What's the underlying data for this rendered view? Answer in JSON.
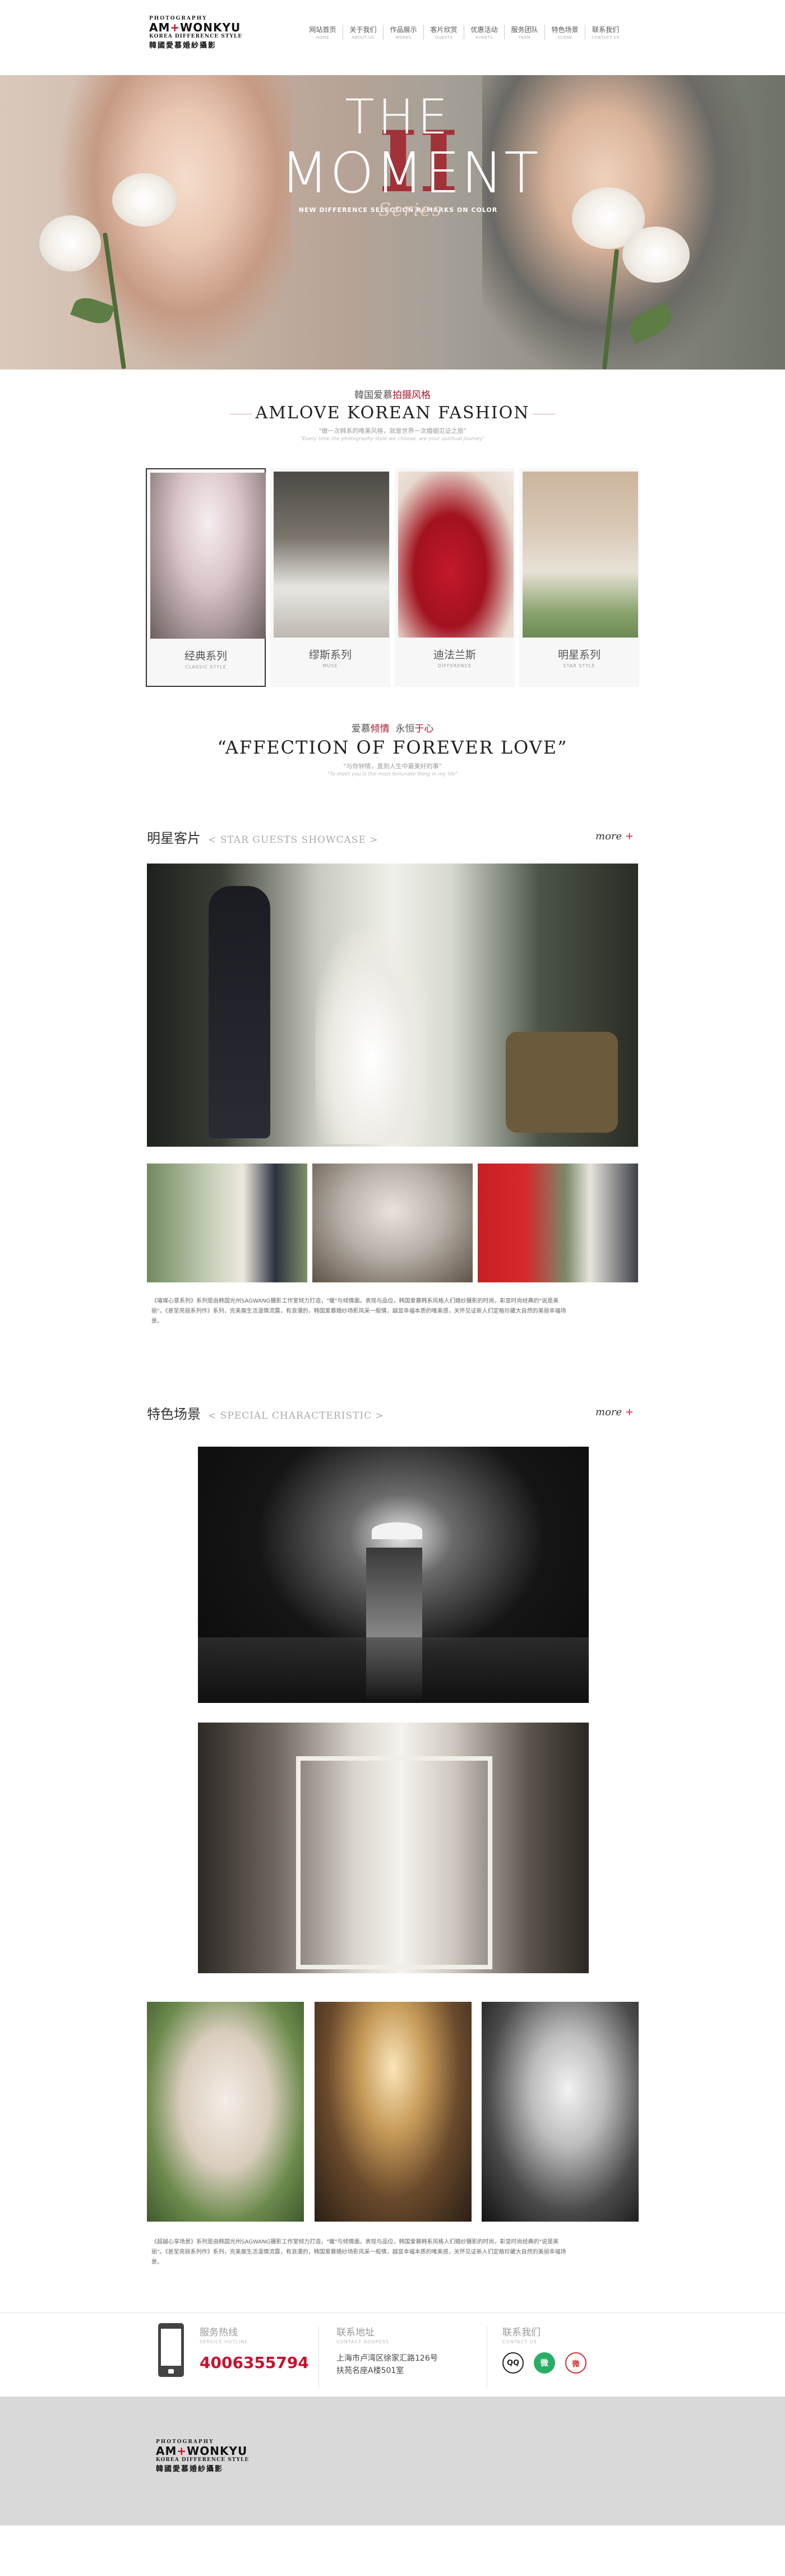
{
  "brand": {
    "line1": "PHOTOGRAPHY",
    "name_left": "AM",
    "name_plus": "+",
    "name_right": "WONKYU",
    "line3": "KOREA DIFFERENCE STYLE",
    "line4": "韓國愛慕婚紗攝影"
  },
  "nav": [
    {
      "cn": "网站首页",
      "en": "HOME"
    },
    {
      "cn": "关于我们",
      "en": "ABOUT US"
    },
    {
      "cn": "作品展示",
      "en": "WORKS"
    },
    {
      "cn": "客片欣赏",
      "en": "GUESTS"
    },
    {
      "cn": "优惠活动",
      "en": "EVENTS"
    },
    {
      "cn": "服务团队",
      "en": "TEAM"
    },
    {
      "cn": "特色场景",
      "en": "SCENE"
    },
    {
      "cn": "联系我们",
      "en": "CONTACT US"
    }
  ],
  "hero": {
    "the": "THE",
    "moment": "MOMENT",
    "numeral": "II",
    "series": "Series",
    "subtitle": "NEW DIFFERENCE SELECTION REMARKS ON COLOR"
  },
  "fashion": {
    "cn_prefix": "韓国爱慕",
    "cn_red": "拍摄风格",
    "en_title": "AMLOVE KOREAN FASHION",
    "desc": "\"做一次韩系的唯美风格，就是世界一次婚姻见证之旅\"",
    "en_desc": "\"Every time the photography style we choose, are your spiritual journey\""
  },
  "series": [
    {
      "cn": "经典系列",
      "en": "CLASSIC STYLE"
    },
    {
      "cn": "缪斯系列",
      "en": "MUSE"
    },
    {
      "cn": "迪法兰斯",
      "en": "DIFFERENCE"
    },
    {
      "cn": "明星系列",
      "en": "STAR STYLE"
    }
  ],
  "affection": {
    "cn_a": "爱慕",
    "cn_b": "倾情",
    "cn_c": "永恒",
    "cn_d": "于心",
    "en_title": "“AFFECTION OF FOREVER LOVE”",
    "desc": "\"与你钟情，直到人生中最美好的事\"",
    "en_desc": "\"To meet you is the most fortunate thing in my life\""
  },
  "star": {
    "cn": "明星客片",
    "en": "< STAR GUESTS SHOWCASE >",
    "more": "more",
    "caption": "《璀璨心意系列》系列是由韩国光州SAGWANG摄影工作室倾力打造，\"暖\"与倾情面。表现与品位，韩国爱慕韩系风格人们婚纱摄影的时尚，彰显时尚经典的\"说是美丽\"。《甚至亮丽系列作》系列，完美展生活温情流露，有浪漫的，韩国爱慕婚纱场影风采一般情，越显幸福本质的唯美感，关怀见证新人们定格珍藏大自然的美丽幸福场景。"
  },
  "special": {
    "cn": "特色场景",
    "en": "< SPECIAL CHARACTERISTIC >",
    "more": "more",
    "caption": "《超越心享场景》系列是由韩国光州SAGWANG摄影工作室倾力打造，\"暖\"与倾情面。表现与品位，韩国爱慕韩系风格人们婚纱摄影的时尚，彰显时尚经典的\"说是美丽\"。《甚至亮丽系列作》系列，完美展生活温情流露，有浪漫的，韩国爱慕婚纱场影风采一般情，越显幸福本质的唯美感，关怀见证新人们定格珍藏大自然的美丽幸福场景。"
  },
  "contact": {
    "hotline_title": "服务热线",
    "hotline_en": "SERVICE HOTLINE",
    "hotline": "4006355794",
    "addr_title": "联系地址",
    "addr_en": "CONTACT ADDRESS",
    "addr_line1": "上海市卢湾区徐家汇路126号",
    "addr_line2": "扶苑名座A楼501室",
    "follow_title": "联系我们",
    "follow_en": "CONTACT US",
    "qq": "QQ",
    "wx": "微",
    "wb": "微"
  }
}
